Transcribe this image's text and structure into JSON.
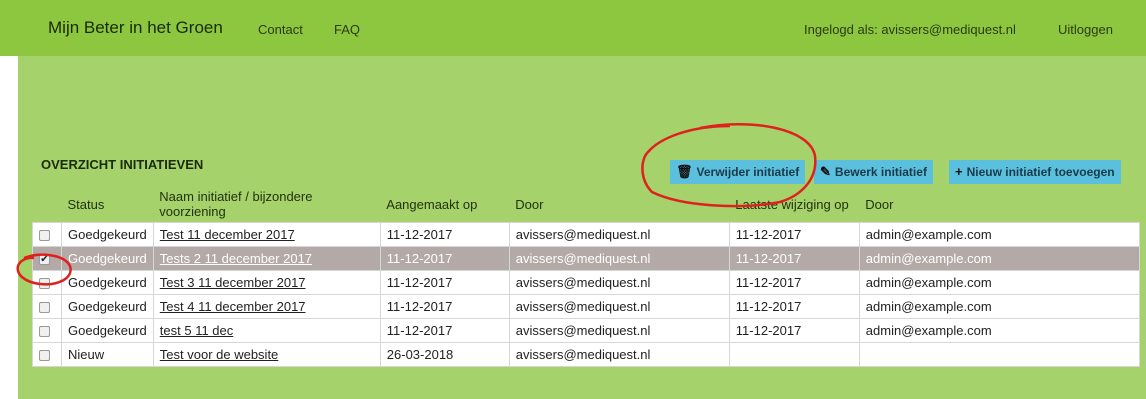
{
  "header": {
    "brand": "Mijn Beter in het Groen",
    "nav": [
      "Contact",
      "FAQ"
    ],
    "logged_in": "Ingelogd als: avissers@mediquest.nl",
    "logout": "Uitloggen"
  },
  "section_title": "OVERZICHT INITIATIEVEN",
  "toolbar": {
    "delete": "Verwijder initiatief",
    "edit": "Bewerk initiatief",
    "add": "Nieuw initiatief toevoegen"
  },
  "table": {
    "headers": [
      "",
      "Status",
      "Naam initiatief / bijzondere voorziening",
      "Aangemaakt op",
      "Door",
      "Laatste wijziging op",
      "Door"
    ],
    "rows": [
      {
        "checked": false,
        "status": "Goedgekeurd",
        "name": "Test 11 december 2017",
        "created": "11-12-2017",
        "by": "avissers@mediquest.nl",
        "modified": "11-12-2017",
        "mod_by": "admin@example.com"
      },
      {
        "checked": true,
        "status": "Goedgekeurd",
        "name": "Tests 2 11 december 2017",
        "created": "11-12-2017",
        "by": "avissers@mediquest.nl",
        "modified": "11-12-2017",
        "mod_by": "admin@example.com"
      },
      {
        "checked": false,
        "status": "Goedgekeurd",
        "name": "Test 3 11 december 2017",
        "created": "11-12-2017",
        "by": "avissers@mediquest.nl",
        "modified": "11-12-2017",
        "mod_by": "admin@example.com"
      },
      {
        "checked": false,
        "status": "Goedgekeurd",
        "name": "Test 4 11 december 2017",
        "created": "11-12-2017",
        "by": "avissers@mediquest.nl",
        "modified": "11-12-2017",
        "mod_by": "admin@example.com"
      },
      {
        "checked": false,
        "status": "Goedgekeurd",
        "name": "test 5 11 dec",
        "created": "11-12-2017",
        "by": "avissers@mediquest.nl",
        "modified": "11-12-2017",
        "mod_by": "admin@example.com"
      },
      {
        "checked": false,
        "status": "Nieuw",
        "name": "Test voor de website",
        "created": "26-03-2018",
        "by": "avissers@mediquest.nl",
        "modified": "",
        "mod_by": ""
      }
    ]
  },
  "colors": {
    "header_green": "#8dc63f",
    "content_green": "#a5d26a",
    "button_blue": "#5bc0de",
    "selected_row": "#b3a9a6",
    "annotation_red": "#e0201e"
  }
}
